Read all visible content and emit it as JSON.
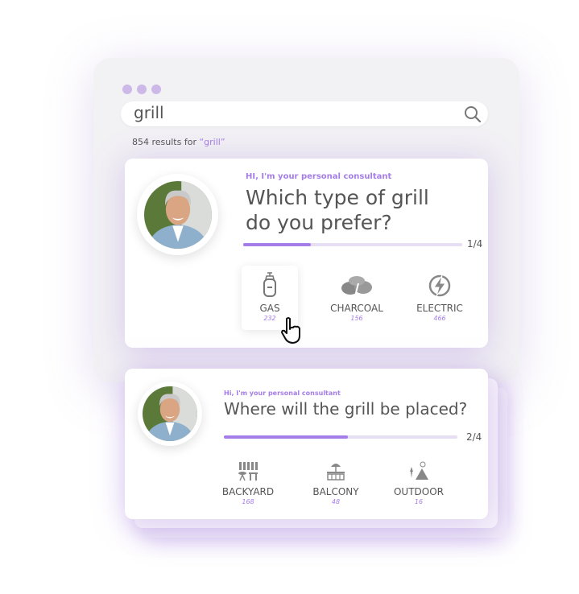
{
  "colors": {
    "accent": "#a57de8",
    "window_dots": "#cdb9e8",
    "track": "#e6def3"
  },
  "search": {
    "value": "grill",
    "icon": "search-icon"
  },
  "results": {
    "text": "854 results for ",
    "query": "“grill”"
  },
  "card1": {
    "greeting": "HI, I'm your personal consultant",
    "title_line1": "Which type of grill",
    "title_line2": "do you prefer?",
    "progress": 0.31,
    "step": "1/4",
    "options": [
      {
        "label": "GAS",
        "count": "232",
        "icon": "gas-cylinder-icon",
        "selected": true
      },
      {
        "label": "CHARCOAL",
        "count": "156",
        "icon": "charcoal-icon"
      },
      {
        "label": "ELECTRIC",
        "count": "466",
        "icon": "lightning-icon"
      }
    ]
  },
  "card2": {
    "greeting": "Hi, I'm your personal consultant",
    "title": "Where will the grill be placed?",
    "progress": 0.53,
    "step": "2/4",
    "options": [
      {
        "label": "BACKYARD",
        "count": "168",
        "icon": "backyard-icon"
      },
      {
        "label": "BALCONY",
        "count": "48",
        "icon": "balcony-icon"
      },
      {
        "label": "OUTDOOR",
        "count": "16",
        "icon": "outdoor-tent-icon"
      }
    ]
  }
}
